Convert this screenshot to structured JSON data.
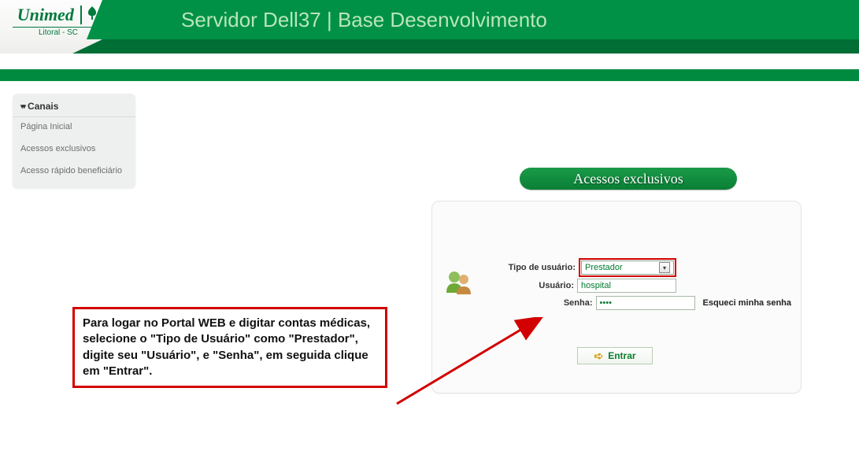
{
  "logo": {
    "brand": "Unimed",
    "sub": "Litoral - SC"
  },
  "header": {
    "title": "Servidor Dell37 | Base Desenvolvimento"
  },
  "sidebar": {
    "title": "Canais",
    "items": [
      {
        "label": "Página Inicial"
      },
      {
        "label": "Acessos exclusivos"
      },
      {
        "label": "Acesso rápido beneficiário"
      }
    ]
  },
  "login": {
    "panel_title": "Acessos exclusivos",
    "tipo_label": "Tipo de usuário:",
    "tipo_value": "Prestador",
    "user_label": "Usuário:",
    "user_value": "hospital",
    "pass_label": "Senha:",
    "pass_value": "••••",
    "forgot": "Esqueci minha senha",
    "entrar": "Entrar"
  },
  "callout": {
    "text": "Para logar no Portal WEB e digitar contas médicas, selecione o \"Tipo de Usuário\" como \"Prestador\", digite seu \"Usuário\", e \"Senha\", em seguida clique em \"Entrar\"."
  }
}
